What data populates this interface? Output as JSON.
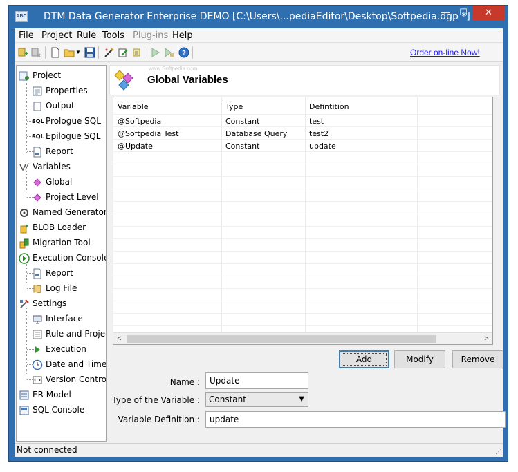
{
  "window": {
    "title": "DTM Data Generator Enterprise DEMO [C:\\Users\\...pediaEditor\\Desktop\\Softpedia.dgp *]",
    "app_icon_text": "ABC",
    "minimize": "—",
    "maximize": "☐",
    "close": "✕"
  },
  "menu": [
    "File",
    "Project",
    "Rule",
    "Tools",
    "Plug-ins",
    "Help"
  ],
  "toolbar": {
    "order_link": "Order on-line Now!"
  },
  "tree": [
    {
      "label": "Project",
      "icon": "project-icon"
    },
    {
      "label": "Properties",
      "icon": "properties-icon"
    },
    {
      "label": "Output",
      "icon": "output-icon"
    },
    {
      "label": "Prologue SQL",
      "icon": "sql-icon",
      "icon_text": "SQL"
    },
    {
      "label": "Epilogue SQL",
      "icon": "sql-icon",
      "icon_text": "SQL"
    },
    {
      "label": "Report",
      "icon": "report-icon"
    },
    {
      "label": "Variables",
      "icon": "variables-icon"
    },
    {
      "label": "Global",
      "icon": "global-variable-icon"
    },
    {
      "label": "Project Level",
      "icon": "project-level-icon"
    },
    {
      "label": "Named Generators",
      "icon": "named-generators-icon"
    },
    {
      "label": "BLOB Loader",
      "icon": "blob-loader-icon"
    },
    {
      "label": "Migration Tool",
      "icon": "migration-tool-icon"
    },
    {
      "label": "Execution Console",
      "icon": "execution-console-icon"
    },
    {
      "label": "Report",
      "icon": "report-icon"
    },
    {
      "label": "Log File",
      "icon": "log-file-icon"
    },
    {
      "label": "Settings",
      "icon": "settings-icon"
    },
    {
      "label": "Interface",
      "icon": "interface-icon"
    },
    {
      "label": "Rule and Project",
      "icon": "rule-project-icon"
    },
    {
      "label": "Execution",
      "icon": "execution-icon"
    },
    {
      "label": "Date and Time",
      "icon": "clock-icon"
    },
    {
      "label": "Version Control",
      "icon": "version-control-icon"
    },
    {
      "label": "ER-Model",
      "icon": "er-model-icon"
    },
    {
      "label": "SQL Console",
      "icon": "sql-console-icon"
    }
  ],
  "panel": {
    "title": "Global Variables",
    "watermark": "www.Softpedia.com"
  },
  "table": {
    "columns": [
      "Variable",
      "Type",
      "Defintition"
    ],
    "rows": [
      [
        "@Softpedia",
        "Constant",
        "test"
      ],
      [
        "@Softpedia Test",
        "Database Query",
        "test2"
      ],
      [
        "@Update",
        "Constant",
        "update"
      ]
    ]
  },
  "buttons": {
    "add": "Add",
    "modify": "Modify",
    "remove": "Remove"
  },
  "form": {
    "name_label": "Name :",
    "name_value": "Update",
    "type_label": "Type of the Variable :",
    "type_value": "Constant",
    "definition_label": "Variable Definition :",
    "definition_value": "update"
  },
  "status": {
    "text": "Not connected"
  },
  "colors": {
    "title_bar": "#2f6fb0",
    "close_button": "#c7392b",
    "link": "#1a1aff"
  }
}
